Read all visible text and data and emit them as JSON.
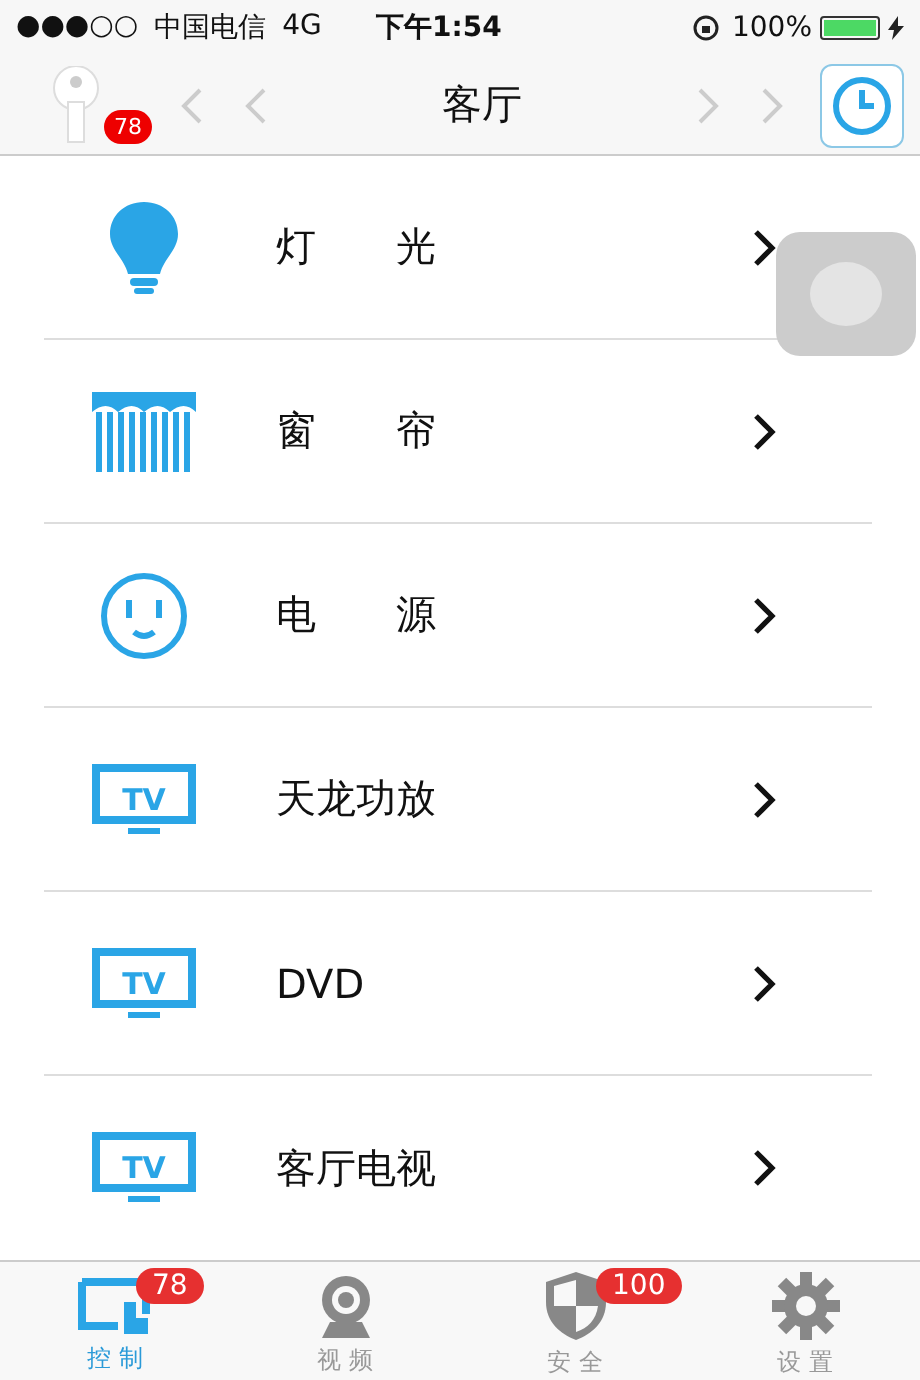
{
  "status_bar": {
    "signal": "●●●○○",
    "carrier": "中国电信",
    "network": "4G",
    "time": "下午1:54",
    "battery": "100%"
  },
  "header": {
    "title": "客厅",
    "key_badge": "78"
  },
  "devices": [
    {
      "kind": "bulb",
      "label": "灯　　光"
    },
    {
      "kind": "curtain",
      "label": "窗　　帘"
    },
    {
      "kind": "socket",
      "label": "电　　源"
    },
    {
      "kind": "tv",
      "icon_label": "TV",
      "label": "天龙功放"
    },
    {
      "kind": "tv",
      "icon_label": "TV",
      "label": "DVD"
    },
    {
      "kind": "tv",
      "icon_label": "TV",
      "label": "客厅电视"
    }
  ],
  "tab_bar": [
    {
      "kind": "control",
      "label": "控 制",
      "badge": "78",
      "selected": true
    },
    {
      "kind": "camera",
      "label": "视 频",
      "selected": false
    },
    {
      "kind": "shield",
      "label": "安 全",
      "badge": "100",
      "selected": false
    },
    {
      "kind": "gear",
      "label": "设 置",
      "selected": false
    }
  ]
}
